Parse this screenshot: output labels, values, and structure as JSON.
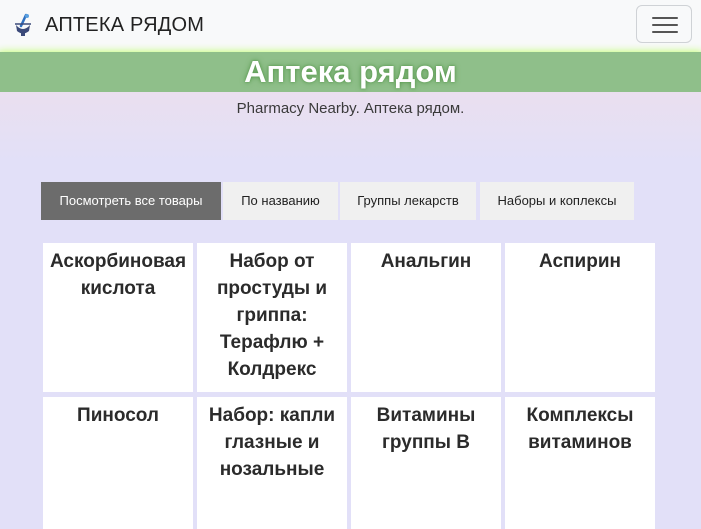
{
  "navbar": {
    "brand": "АПТЕКА РЯДОМ",
    "logo_icon": "pharmacy-mortar-icon",
    "menu_icon": "hamburger-menu-icon"
  },
  "hero": {
    "title": "Аптека рядом",
    "subtitle": "Pharmacy Nearby. Аптека рядом."
  },
  "tabs": [
    {
      "label": "Посмотреть все товары",
      "active": true
    },
    {
      "label": "По названию",
      "active": false
    },
    {
      "label": "Группы лекарств",
      "active": false
    },
    {
      "label": "Наборы и коплексы",
      "active": false
    }
  ],
  "products": [
    {
      "name": "Аскорбиновая кислота"
    },
    {
      "name": "Набор от простуды и гриппа: Терафлю + Колдрекс"
    },
    {
      "name": "Анальгин"
    },
    {
      "name": "Аспирин"
    },
    {
      "name": "Пиносол"
    },
    {
      "name": "Набор: капли глазные и нозальные"
    },
    {
      "name": "Витамины группы В"
    },
    {
      "name": "Комплексы витаминов"
    }
  ],
  "colors": {
    "page_background": "#e2e0f8",
    "hero_band": "#8fbf8a",
    "hero_glow": "#b8ff5a",
    "active_tab": "#6c6c6c",
    "tab": "#f0f0f0"
  }
}
